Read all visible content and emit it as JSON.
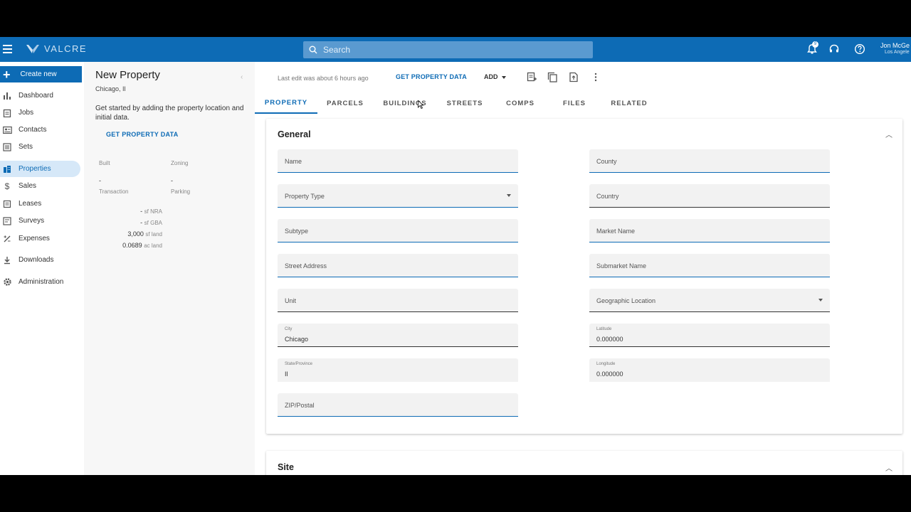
{
  "topbar": {
    "brand": "VALCRE",
    "search_placeholder": "Search",
    "notification_count": "9",
    "user_name": "Jon McGe",
    "user_location": "Los Angele"
  },
  "sidebar": {
    "create_label": "Create new",
    "items": [
      {
        "label": "Dashboard",
        "icon": "bar-chart-icon"
      },
      {
        "label": "Jobs",
        "icon": "clipboard-icon"
      },
      {
        "label": "Contacts",
        "icon": "contact-card-icon"
      },
      {
        "label": "Sets",
        "icon": "list-icon"
      },
      {
        "label": "Properties",
        "icon": "building-icon",
        "active": true
      },
      {
        "label": "Sales",
        "icon": "dollar-icon"
      },
      {
        "label": "Leases",
        "icon": "document-icon"
      },
      {
        "label": "Surveys",
        "icon": "survey-icon"
      },
      {
        "label": "Expenses",
        "icon": "expense-icon"
      },
      {
        "label": "Downloads",
        "icon": "download-icon"
      },
      {
        "label": "Administration",
        "icon": "gear-icon"
      }
    ]
  },
  "panel": {
    "title": "New Property",
    "location": "Chicago, Il",
    "description": "Get started by adding the property location and initial data.",
    "get_data_label": "GET PROPERTY DATA",
    "built_label": "Built",
    "built_value": "-",
    "zoning_label": "Zoning",
    "zoning_value": "-",
    "transaction_label": "Transaction",
    "parking_label": "Parking",
    "stats": [
      {
        "value": "-",
        "unit": "sf NRA"
      },
      {
        "value": "-",
        "unit": "sf GBA"
      },
      {
        "value": "3,000",
        "unit": "sf land"
      },
      {
        "value": "0.0689",
        "unit": "ac land"
      }
    ]
  },
  "actionbar": {
    "last_edit": "Last edit was about 6 hours ago",
    "get_data_label": "GET PROPERTY DATA",
    "add_label": "ADD"
  },
  "tabs": [
    "PROPERTY",
    "PARCELS",
    "BUILDINGS",
    "STREETS",
    "COMPS",
    "FILES",
    "RELATED"
  ],
  "general": {
    "title": "General",
    "left_fields": [
      {
        "label": "Name"
      },
      {
        "label": "Property Type",
        "dropdown": true
      },
      {
        "label": "Subtype"
      },
      {
        "label": "Street Address"
      },
      {
        "label": "Unit"
      },
      {
        "label": "City",
        "value": "Chicago"
      },
      {
        "label": "State/Province",
        "value": "Il"
      },
      {
        "label": "ZIP/Postal"
      }
    ],
    "right_fields": [
      {
        "label": "County"
      },
      {
        "label": "Country"
      },
      {
        "label": "Market Name"
      },
      {
        "label": "Submarket Name"
      },
      {
        "label": "Geographic Location",
        "dropdown": true
      },
      {
        "label": "Latitude",
        "value": "0.000000"
      },
      {
        "label": "Longitude",
        "value": "0.000000"
      }
    ]
  },
  "site": {
    "title": "Site"
  }
}
